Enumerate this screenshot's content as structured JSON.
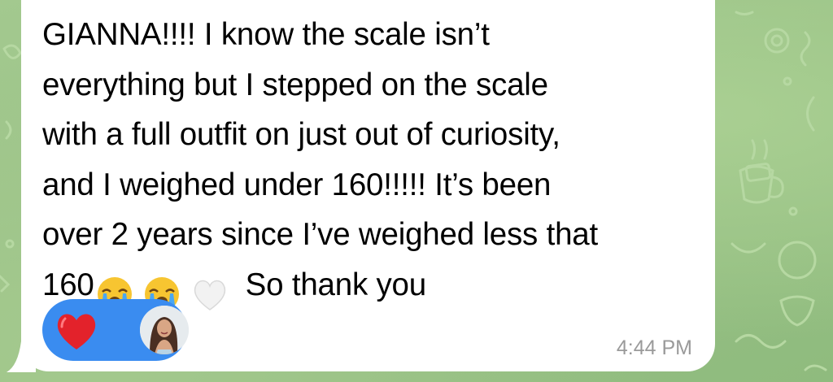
{
  "message": {
    "lines": [
      "GIANNA!!!! I know the scale isn’t",
      "everything but I stepped on the scale",
      "with a full outfit on just out of curiosity,",
      "and I weighed under 160!!!!! It’s been",
      "over 2 years since I’ve weighed less that"
    ],
    "last_line_start": "160",
    "last_line_end": "So thank you",
    "emojis": [
      "loudly-crying-face-emoji",
      "loudly-crying-face-emoji",
      "white-heart-emoji"
    ],
    "timestamp": "4:44 PM"
  },
  "reaction": {
    "emoji": "red-heart-icon",
    "reactor_avatar": "avatar"
  },
  "colors": {
    "bubble": "#ffffff",
    "reaction_pill": "#3a8cf0",
    "wallpaper": "#9cc48a",
    "timestamp": "#9a9a9a",
    "heart": "#e3222b"
  }
}
